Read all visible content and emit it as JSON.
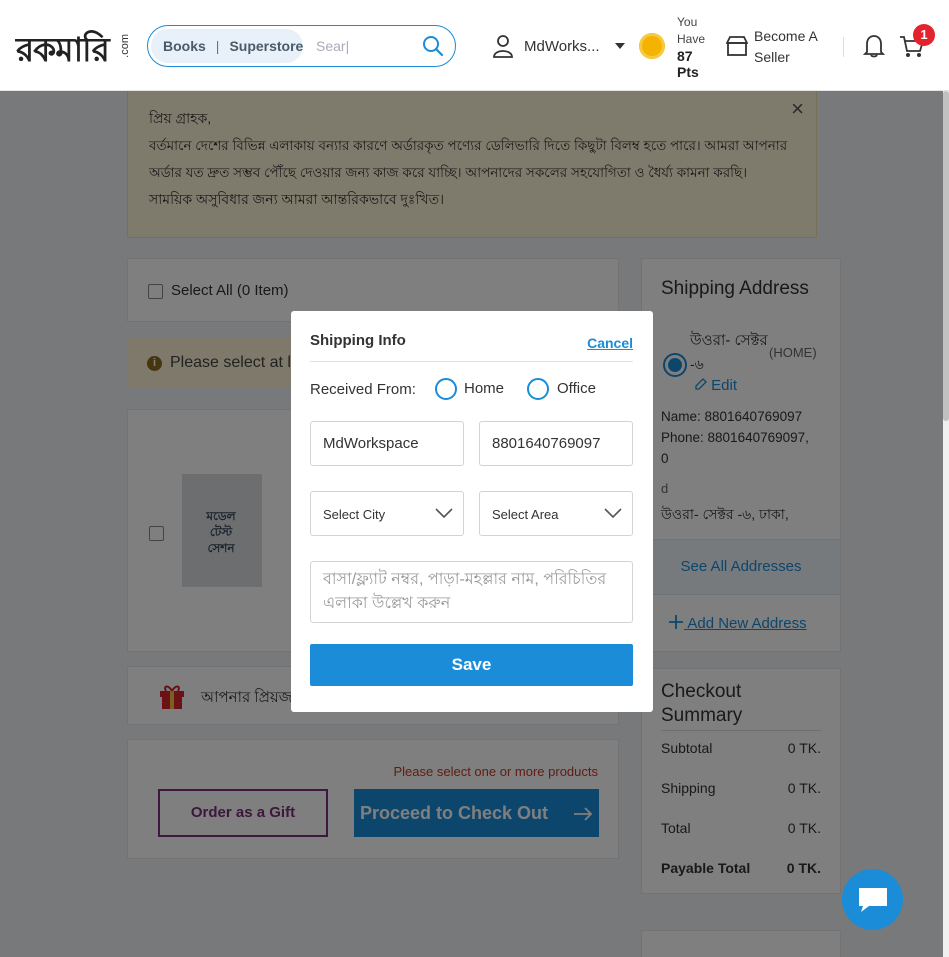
{
  "header": {
    "logo_text": "রকমারি",
    "logo_suffix": ".com",
    "search_tabs": [
      "Books",
      "Superstore"
    ],
    "search_placeholder": "Sear|",
    "user_name": "MdWorks...",
    "points_label_1": "You",
    "points_label_2": "Have",
    "points_value": "87",
    "points_unit": "Pts",
    "seller_line1": "Become A",
    "seller_line2": "Seller",
    "cart_count": "1"
  },
  "notice": {
    "greeting": "প্রিয় গ্রাহক,",
    "line1": "বর্তমানে দেশের বিভিন্ন এলাকায় বন্যার কারণে অর্ডারকৃত পণ্যের ডেলিভারি দিতে কিছুটা বিলম্ব হতে পারে। আমরা আপনার",
    "line2": "অর্ডার যত দ্রুত সম্ভব পৌঁছে দেওয়ার জন্য কাজ করে যাচ্ছি। আপনাদের সকলের সহযোগিতা ও ধৈর্য্য কামনা করছি।",
    "line3": "সাময়িক অসুবিধার জন্য আমরা আন্তরিকভাবে দুঃখিত।",
    "close": "×"
  },
  "cart": {
    "select_all": "Select All (0 Item)",
    "warning": "Please select at l",
    "gift_text": "আপনার প্রিয়জ",
    "error": "Please select one or more products",
    "gift_button": "Order as a Gift",
    "checkout_button": "Proceed to Check Out",
    "book_title": "মডেল টেস্ট সেশন"
  },
  "shipping_address": {
    "title": "Shipping Address",
    "area": "উওরা- সেক্টর",
    "area2": "-৬",
    "tag": "(HOME)",
    "edit": "Edit",
    "name": "Name: 8801640769097",
    "phone": "Phone: 8801640769097,",
    "phone2": "0",
    "d": "d",
    "address": "উওরা- সেক্টর -৬, ঢাকা,",
    "see_all": "See All Addresses",
    "add_new": "Add New Address"
  },
  "summary": {
    "title1": "Checkout",
    "title2": "Summary",
    "rows": [
      {
        "label": "Subtotal",
        "value": "0 TK."
      },
      {
        "label": "Shipping",
        "value": "0 TK."
      },
      {
        "label": "Total",
        "value": "0 TK."
      },
      {
        "label": "Payable Total",
        "value": "0 TK."
      }
    ]
  },
  "modal": {
    "title": "Shipping Info",
    "cancel": "Cancel",
    "received_from": "Received From:",
    "option_home": "Home",
    "option_office": "Office",
    "name_value": "MdWorkspace",
    "phone_value": "8801640769097",
    "city_placeholder": "Select City",
    "area_placeholder": "Select Area",
    "address_placeholder": "বাসা/ফ্ল্যাট নম্বর, পাড়া-মহল্লার নাম, পরিচিতির এলাকা উল্লেখ করুন",
    "save": "Save"
  },
  "colors": {
    "primary": "#1a8cd8",
    "notice_bg": "#fff7d9",
    "gift_purple": "#7a2e7a",
    "error_red": "#c0392b",
    "coin": "#f5b301"
  }
}
